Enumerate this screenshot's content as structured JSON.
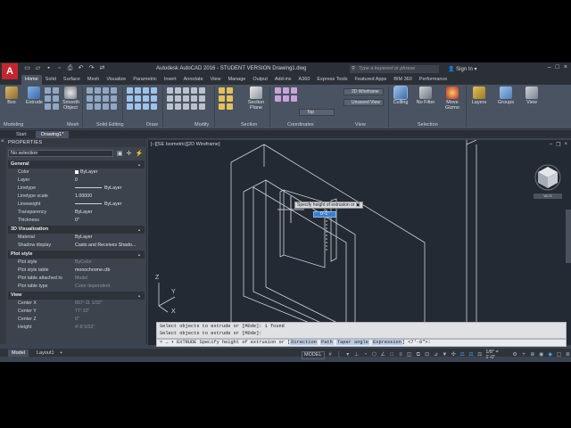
{
  "app": {
    "logo": "A",
    "title": "Autodesk AutoCAD 2016 - STUDENT VERSION   Drawing1.dwg",
    "search_placeholder": "Type a keyword or phrase",
    "signin": "Sign In"
  },
  "ribbon_tabs": [
    "Home",
    "Solid",
    "Surface",
    "Mesh",
    "Visualize",
    "Parametric",
    "Insert",
    "Annotate",
    "View",
    "Manage",
    "Output",
    "Add-ins",
    "A360",
    "Express Tools",
    "Featured Apps",
    "BIM 360",
    "Performance"
  ],
  "ribbon": {
    "buttons": {
      "box": "Box",
      "extrude": "Extrude",
      "smooth_object": "Smooth\nObject",
      "section_plane": "Section\nPlane",
      "culling": "Culling",
      "no_filter": "No Filter",
      "move_gizmo": "Move\nGizmo",
      "layers": "Layers",
      "groups": "Groups",
      "view": "View"
    },
    "dropdowns": {
      "visual_style": "2D Wireframe",
      "saved_view": "Unsaved View",
      "coords": "Top"
    },
    "panels": {
      "modeling": "Modeling",
      "mesh": "Mesh",
      "solid_editing": "Solid Editing",
      "draw": "Draw",
      "modify": "Modify",
      "section": "Section",
      "coordinates": "Coordinates",
      "view": "View",
      "selection": "Selection"
    }
  },
  "doc_tabs": [
    "Start",
    "Drawing1*"
  ],
  "properties": {
    "title": "PROPERTIES",
    "selection": "No selection",
    "sections": [
      {
        "name": "General",
        "rows": [
          {
            "k": "Color",
            "v": "ByLayer",
            "swatch": true
          },
          {
            "k": "Layer",
            "v": "0"
          },
          {
            "k": "Linetype",
            "v": "ByLayer",
            "line": true
          },
          {
            "k": "Linetype scale",
            "v": "1.00000"
          },
          {
            "k": "Lineweight",
            "v": "ByLayer",
            "line": true
          },
          {
            "k": "Transparency",
            "v": "ByLayer"
          },
          {
            "k": "Thickness",
            "v": "0\""
          }
        ]
      },
      {
        "name": "3D Visualization",
        "rows": [
          {
            "k": "Material",
            "v": "ByLayer"
          },
          {
            "k": "Shadow display",
            "v": "Casts and Receives Shado..."
          }
        ]
      },
      {
        "name": "Plot style",
        "rows": [
          {
            "k": "Plot style",
            "v": "ByColor",
            "dim": true
          },
          {
            "k": "Plot style table",
            "v": "monochrome.ctb"
          },
          {
            "k": "Plot table attached to",
            "v": "Model",
            "dim": true
          },
          {
            "k": "Plot table type",
            "v": "Color dependent",
            "dim": true
          }
        ]
      },
      {
        "name": "View",
        "rows": [
          {
            "k": "Center X",
            "v": "657'-11 1/32\"",
            "dim": true
          },
          {
            "k": "Center Y",
            "v": "77'-10\"",
            "dim": true
          },
          {
            "k": "Center Z",
            "v": "0\"",
            "dim": true
          },
          {
            "k": "Height",
            "v": "4'-8 9/32\"",
            "dim": true
          }
        ]
      }
    ]
  },
  "viewport": {
    "label": "[−][SE Isometric][2D Wireframe]",
    "tooltip": "Specify height of extrusion or",
    "input_value": "0'-1\"",
    "viewcube_label": "WCS"
  },
  "command": {
    "history": [
      "Select objects to extrude or [MOde]: 1 found",
      "Select objects to extrude or [MOde]:"
    ],
    "prefix": "× → ▾ EXTRUDE Specify height of extrusion or [",
    "options": [
      "Direction",
      "Path",
      "Taper angle",
      "Expression"
    ],
    "suffix": "] <7'-0\">:"
  },
  "layout_tabs": [
    "Model",
    "Layout1",
    "+"
  ],
  "status": {
    "model": "MODEL",
    "scale": "1/8\" = 1'-0\""
  },
  "colors": {
    "accent": "#3a7fd0",
    "canvas": "#242a33",
    "ribbon": "#4a5361",
    "logo": "#c4262e"
  }
}
